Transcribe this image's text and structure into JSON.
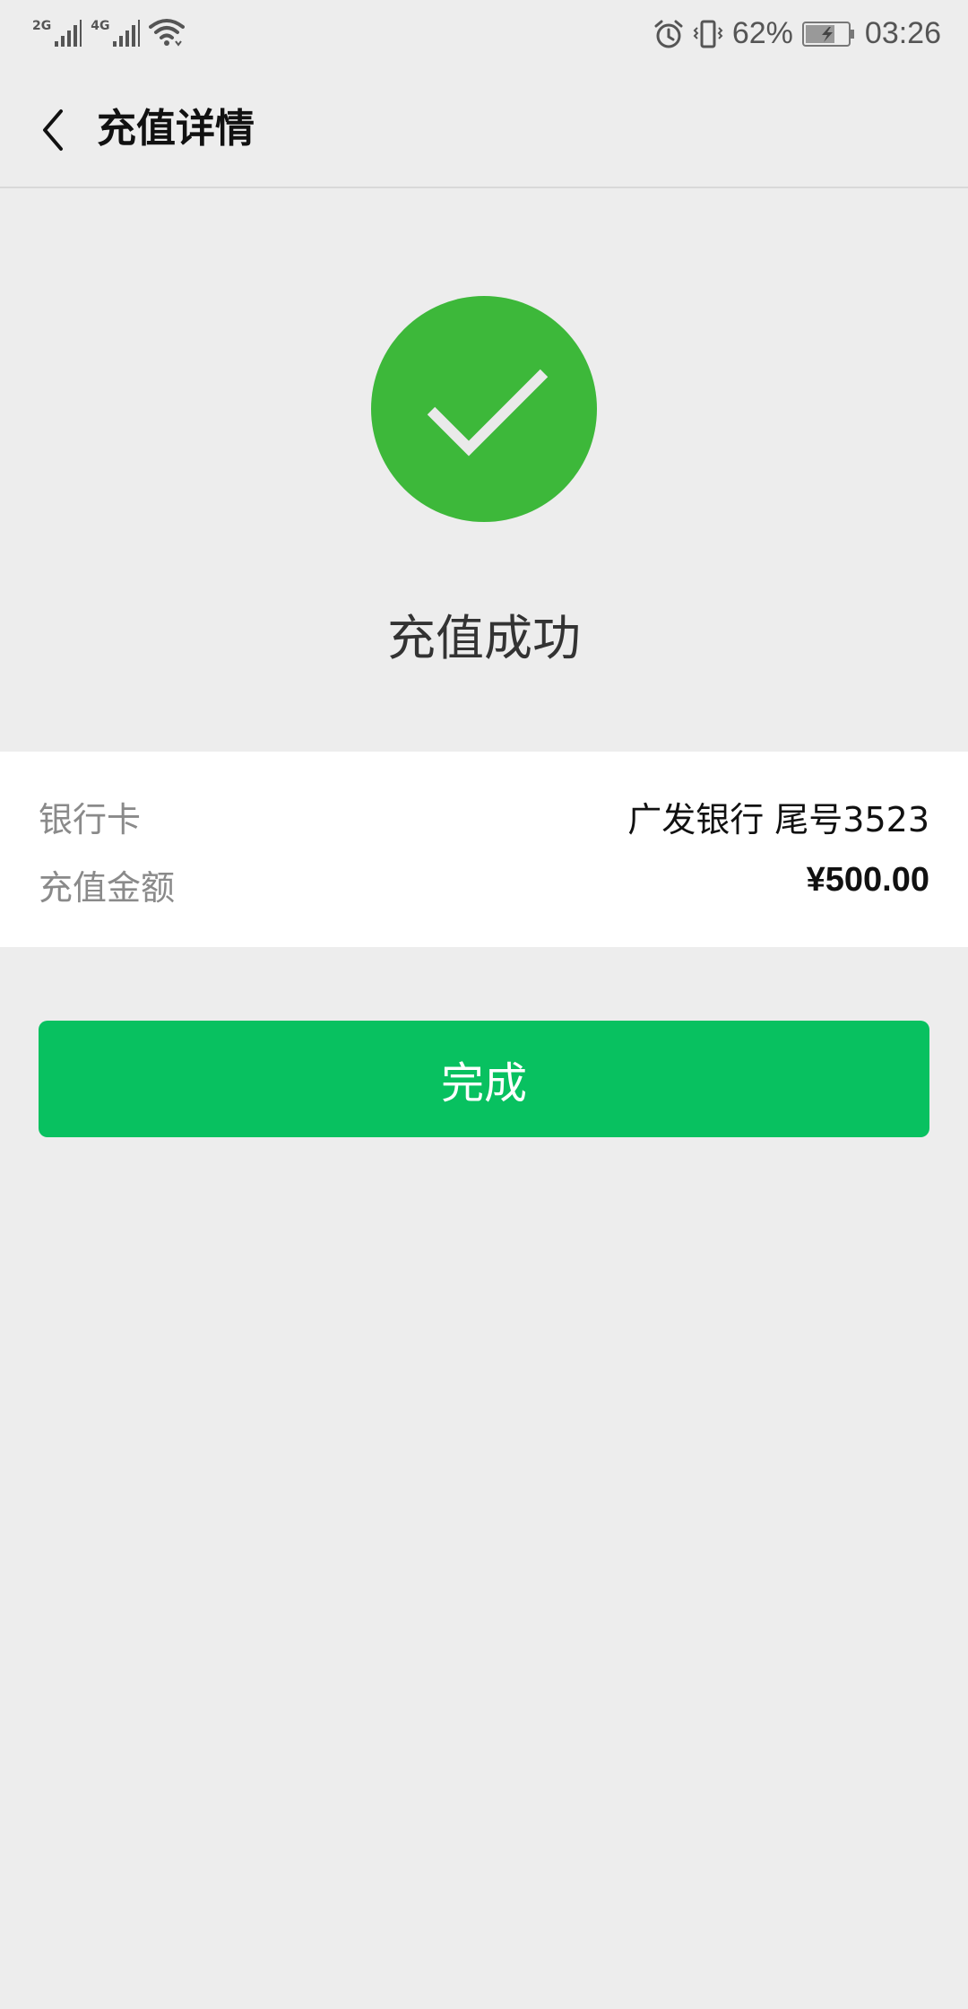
{
  "status_bar": {
    "network_1": "2G",
    "network_2": "4G",
    "battery_percent": "62%",
    "time": "03:26",
    "icons": [
      "signal-icon",
      "wifi-icon",
      "alarm-icon",
      "vibrate-icon",
      "battery-charging-icon"
    ]
  },
  "header": {
    "title": "充值详情",
    "back_icon": "chevron-left-icon"
  },
  "result": {
    "icon": "check-circle-icon",
    "icon_color": "#3db83a",
    "message": "充值成功"
  },
  "details": {
    "rows": [
      {
        "label": "银行卡",
        "value": "广发银行 尾号3523"
      },
      {
        "label": "充值金额",
        "value": "¥500.00"
      }
    ]
  },
  "actions": {
    "done_label": "完成",
    "button_color": "#08c160"
  }
}
